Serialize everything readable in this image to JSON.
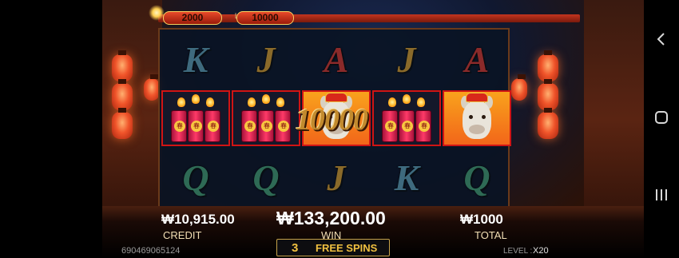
{
  "bets": {
    "left": "2000",
    "right": "10000"
  },
  "reels": {
    "row1": [
      "K",
      "J",
      "A",
      "J",
      "A"
    ],
    "row3": [
      "Q",
      "Q",
      "J",
      "K",
      "Q"
    ],
    "firecracker_glyph": "春"
  },
  "win_popup": "10000",
  "credit": {
    "amount": "₩10,915.00",
    "label": "CREDIT"
  },
  "win": {
    "amount": "₩133,200.00",
    "label": "WIN"
  },
  "total": {
    "amount": "₩1000",
    "label": "TOTAL"
  },
  "free_spins": {
    "count": "3",
    "label": "FREE SPINS"
  },
  "game_id": "690469065124",
  "level": {
    "label": "LEVEL :",
    "value": "X20"
  },
  "nav": {
    "back_icon": "chevron-left-icon",
    "home_icon": "home-icon",
    "recents_icon": "recents-icon"
  }
}
